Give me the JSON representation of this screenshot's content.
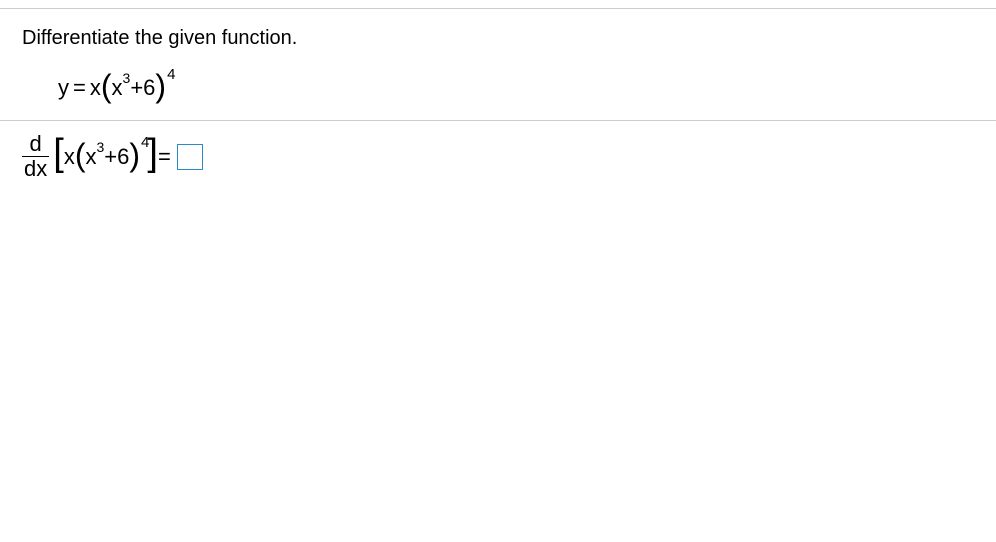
{
  "instruction": "Differentiate the given function.",
  "equation": {
    "lhs": "y",
    "eq": "=",
    "var1": "x",
    "lparen": "(",
    "inner_var": "x",
    "inner_exp": "3",
    "plus": " + ",
    "const": "6",
    "rparen": ")",
    "outer_exp": "4"
  },
  "derivative": {
    "d": "d",
    "dx": "dx",
    "lbracket": "[",
    "var1": "x",
    "lparen": "(",
    "inner_var": "x",
    "inner_exp": "3",
    "plus": " + ",
    "const": "6",
    "rparen": ")",
    "outer_exp": "4",
    "rbracket": "]",
    "eq": " = "
  }
}
